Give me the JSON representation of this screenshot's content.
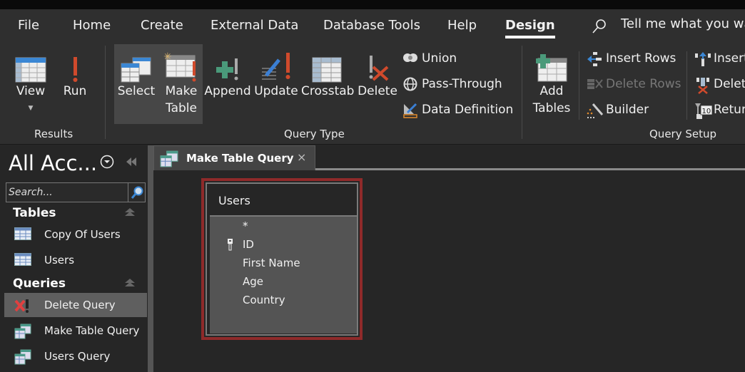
{
  "ribbon_tabs": [
    {
      "label": "File",
      "active": false
    },
    {
      "label": "Home",
      "active": false
    },
    {
      "label": "Create",
      "active": false
    },
    {
      "label": "External Data",
      "active": false
    },
    {
      "label": "Database Tools",
      "active": false
    },
    {
      "label": "Help",
      "active": false
    },
    {
      "label": "Design",
      "active": true
    }
  ],
  "tell_me": {
    "icon": "search-icon",
    "placeholder": "Tell me what you wa"
  },
  "groups": {
    "results": {
      "label": "Results",
      "view": {
        "label": "View",
        "icon": "datasheet-view-icon"
      },
      "run": {
        "label": "Run",
        "icon": "exclamation-run-icon"
      }
    },
    "query_type": {
      "label": "Query Type",
      "select": {
        "label": "Select",
        "icon": "select-query-icon",
        "selected": true
      },
      "make_table": {
        "label1": "Make",
        "label2": "Table",
        "icon": "make-table-icon",
        "selected": true
      },
      "append": {
        "label": "Append",
        "icon": "append-icon"
      },
      "update": {
        "label": "Update",
        "icon": "update-icon"
      },
      "crosstab": {
        "label": "Crosstab",
        "icon": "crosstab-icon"
      },
      "delete": {
        "label": "Delete",
        "icon": "delete-query-icon"
      },
      "union": {
        "label": "Union",
        "icon": "union-icon"
      },
      "pass_through": {
        "label": "Pass-Through",
        "icon": "globe-icon"
      },
      "data_definition": {
        "label": "Data Definition",
        "icon": "data-definition-icon"
      }
    },
    "query_setup": {
      "label": "Query Setup",
      "add_tables": {
        "label1": "Add",
        "label2": "Tables",
        "icon": "add-table-icon"
      },
      "insert_rows": {
        "label": "Insert Rows",
        "icon": "insert-rows-icon"
      },
      "delete_rows": {
        "label": "Delete Rows",
        "icon": "delete-rows-icon",
        "disabled": true
      },
      "builder": {
        "label": "Builder",
        "icon": "builder-wand-icon"
      },
      "insert_columns": {
        "label": "Insert",
        "icon": "insert-columns-icon"
      },
      "delete_columns": {
        "label": "Delete",
        "icon": "delete-columns-icon"
      },
      "return": {
        "label": "Retur",
        "icon": "return-top-icon",
        "value": "10"
      }
    }
  },
  "nav_pane": {
    "title": "All Acc...",
    "search_placeholder": "Search...",
    "sections": [
      {
        "header": "Tables",
        "items": [
          {
            "label": "Copy Of Users",
            "icon": "table-icon"
          },
          {
            "label": "Users",
            "icon": "table-icon"
          }
        ]
      },
      {
        "header": "Queries",
        "items": [
          {
            "label": "Delete Query",
            "icon": "delete-query-icon",
            "selected": true
          },
          {
            "label": "Make Table Query",
            "icon": "query-icon"
          },
          {
            "label": "Users Query",
            "icon": "query-icon"
          }
        ]
      }
    ]
  },
  "document_tab": {
    "label": "Make Table Query",
    "close": "×"
  },
  "field_list": {
    "title": "Users",
    "fields": [
      {
        "name": "*",
        "primary_key": false
      },
      {
        "name": "ID",
        "primary_key": true
      },
      {
        "name": "First Name",
        "primary_key": false
      },
      {
        "name": "Age",
        "primary_key": false
      },
      {
        "name": "Country",
        "primary_key": false
      }
    ]
  },
  "colors": {
    "accent_red": "#d04a2c",
    "selection_border": "#8f2a2a",
    "ribbon_bg": "#2f2f2f"
  }
}
